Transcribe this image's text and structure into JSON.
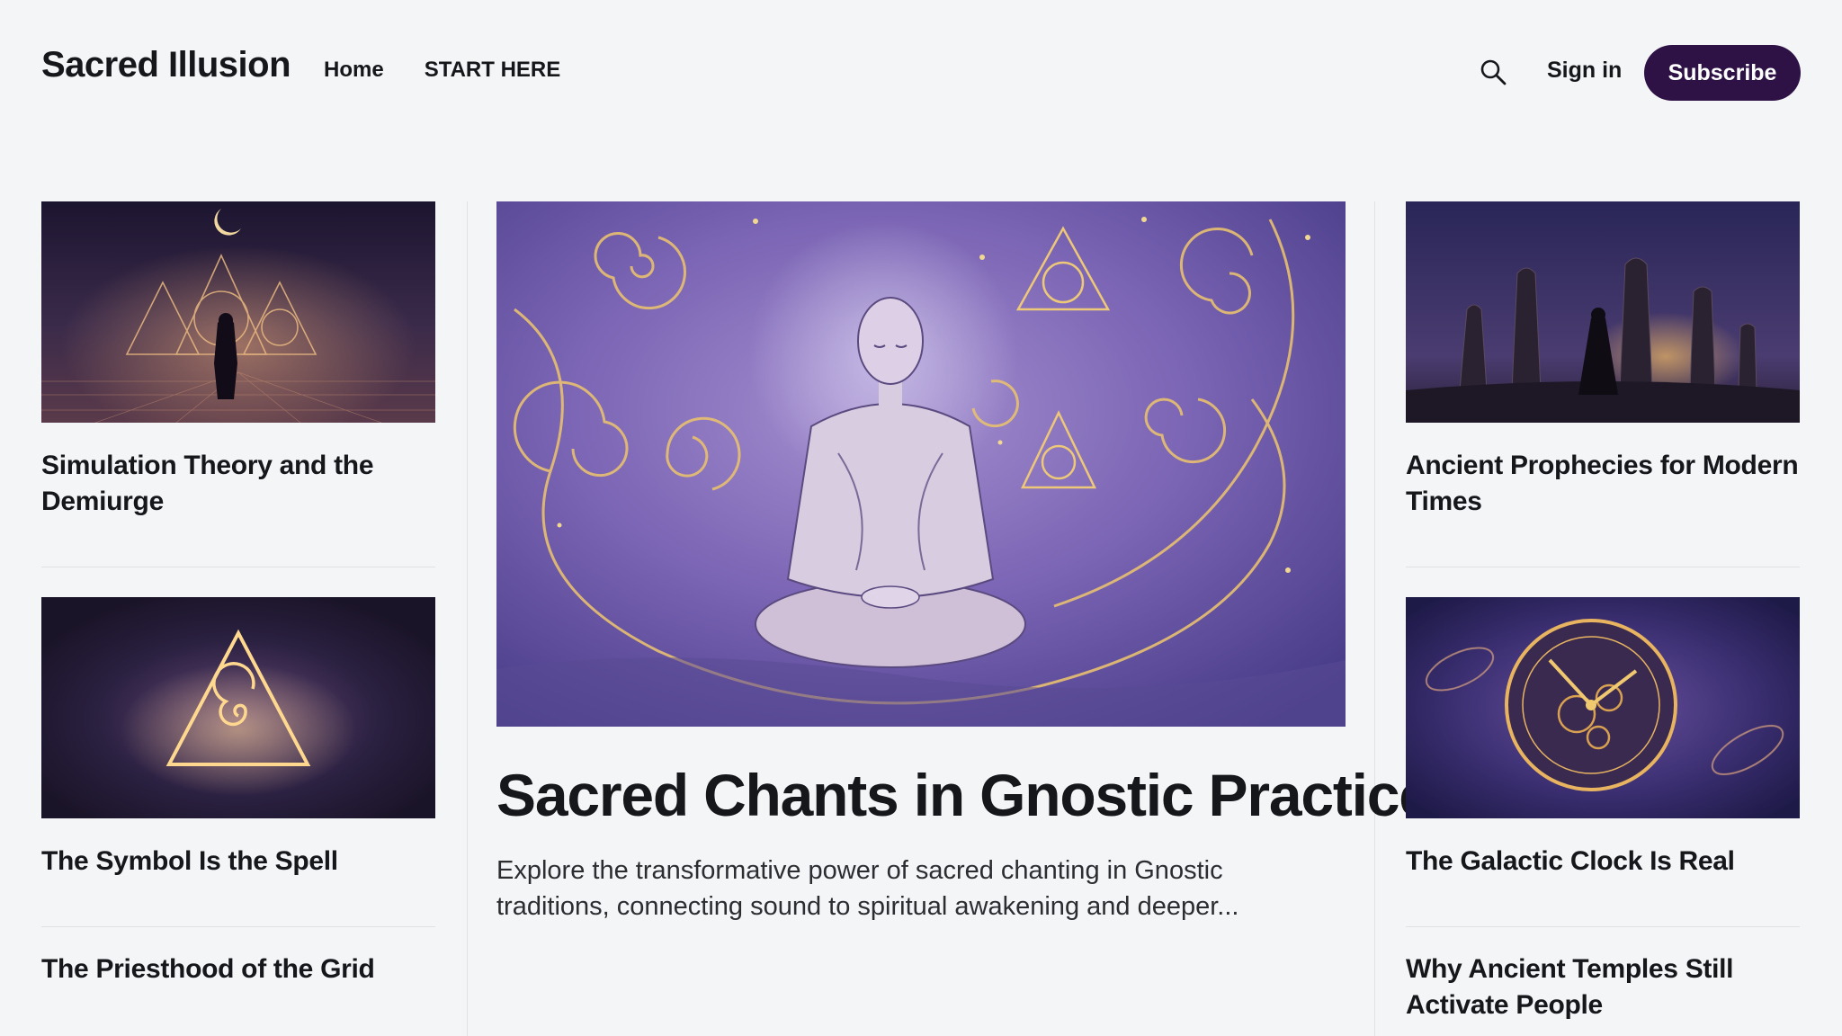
{
  "site": {
    "title": "Sacred Illusion"
  },
  "nav": {
    "items": [
      "Home",
      "START HERE"
    ]
  },
  "header": {
    "signin_label": "Sign in",
    "subscribe_label": "Subscribe"
  },
  "left_column": {
    "posts": [
      {
        "title": "Simulation Theory and the Demiurge"
      },
      {
        "title": "The Symbol Is the Spell"
      },
      {
        "title": "The Priesthood of the Grid"
      }
    ]
  },
  "featured": {
    "title": "Sacred Chants in Gnostic Practice",
    "excerpt": "Explore the transformative power of sacred chanting in Gnostic traditions, connecting sound to spiritual awakening and deeper..."
  },
  "right_column": {
    "posts": [
      {
        "title": "Ancient Prophecies for Modern Times"
      },
      {
        "title": "The Galactic Clock Is Real"
      },
      {
        "title": "Why Ancient Temples Still Activate People"
      }
    ]
  },
  "colors": {
    "accent": "#2e1245",
    "background": "#f4f5f7",
    "text": "#15171a",
    "gold": "#e8b860",
    "purple": "#5b4a9a"
  },
  "icons": {
    "search": "search-icon"
  }
}
